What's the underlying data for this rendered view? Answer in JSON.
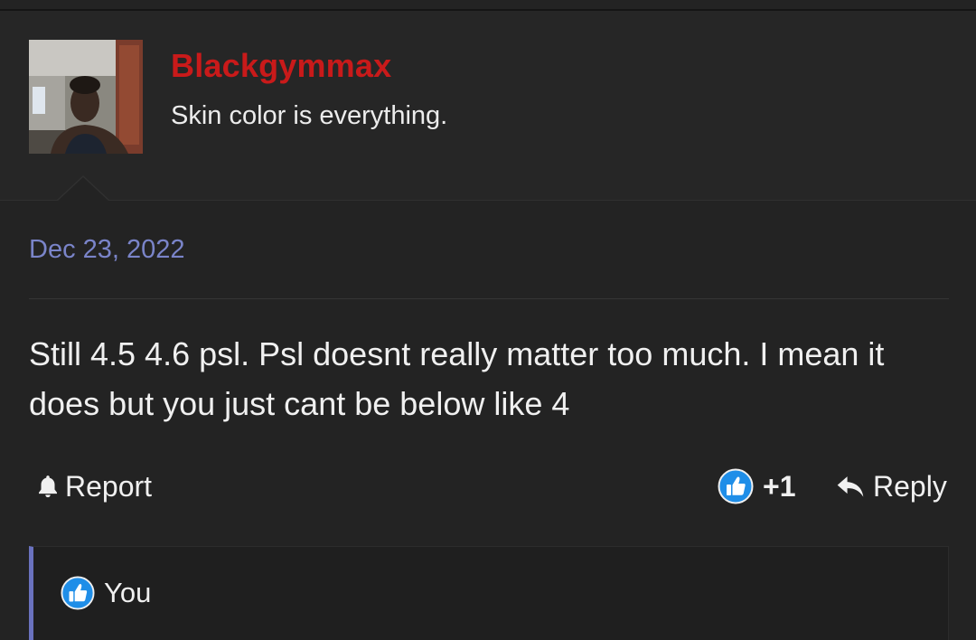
{
  "user": {
    "name": "Blackgymmax",
    "title": "Skin color is everything."
  },
  "post": {
    "date": "Dec 23, 2022",
    "body": "Still 4.5 4.6 psl. Psl doesnt really matter too much. I mean it does but you just cant be below like 4"
  },
  "actions": {
    "report_label": "Report",
    "reaction_count": "+1",
    "reply_label": "Reply"
  },
  "reactions": {
    "list_label": "You"
  },
  "colors": {
    "background": "#232323",
    "username": "#c91a1a",
    "date": "#7a84c9",
    "accent_border": "#6a72bf",
    "like_icon": "#1f8ee8"
  },
  "icons": {
    "report": "bell-icon",
    "like": "thumbs-up-icon",
    "reply": "reply-arrow-icon"
  }
}
